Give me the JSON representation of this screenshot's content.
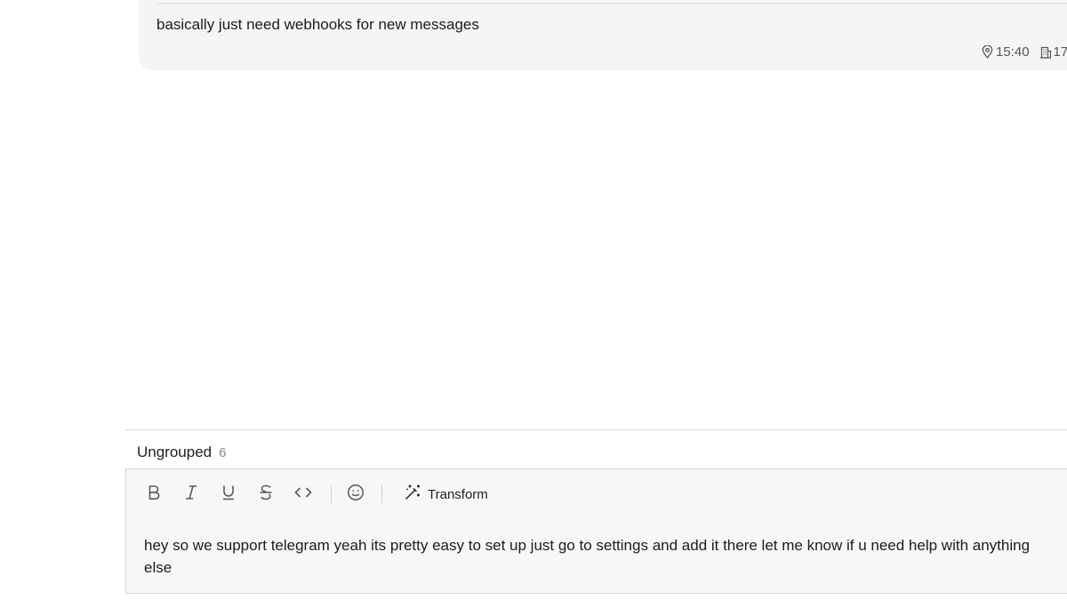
{
  "message": {
    "text": "basically just need webhooks for new messages",
    "meta": {
      "time_icon": "location-pin-icon",
      "time": "15:40",
      "building_icon": "building-icon",
      "count": "17"
    }
  },
  "group": {
    "title": "Ungrouped",
    "count": "6"
  },
  "composer": {
    "toolbar": {
      "bold_icon": "bold-icon",
      "italic_icon": "italic-icon",
      "underline_icon": "underline-icon",
      "strikethrough_icon": "strikethrough-icon",
      "code_icon": "code-icon",
      "emoji_icon": "emoji-icon",
      "transform_icon": "magic-wand-icon",
      "transform_label": "Transform"
    },
    "value": "hey so we support telegram yeah its pretty easy to set up just go to settings and add it there let me know if u need help with anything else"
  }
}
